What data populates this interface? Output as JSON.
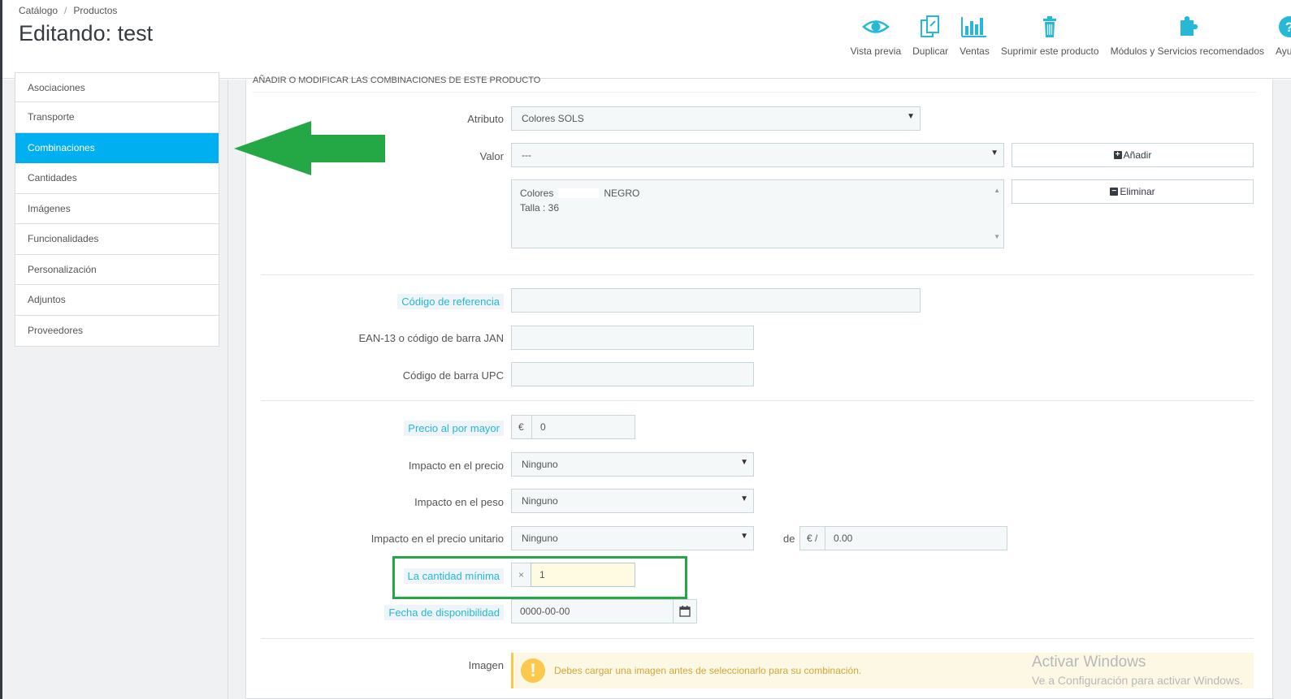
{
  "breadcrumb": {
    "item1": "Catálogo",
    "separator": "/",
    "item2": "Productos"
  },
  "page_title": "Editando: test",
  "toolbar": {
    "preview": "Vista previa",
    "duplicate": "Duplicar",
    "sales": "Ventas",
    "delete": "Suprimir este producto",
    "modules": "Módulos y Servicios recomendados",
    "help": "Ayuda"
  },
  "sidebar": {
    "items": [
      {
        "label": "Asociaciones"
      },
      {
        "label": "Transporte"
      },
      {
        "label": "Combinaciones"
      },
      {
        "label": "Cantidades"
      },
      {
        "label": "Imágenes"
      },
      {
        "label": "Funcionalidades"
      },
      {
        "label": "Personalización"
      },
      {
        "label": "Adjuntos"
      },
      {
        "label": "Proveedores"
      }
    ],
    "active": "Combinaciones"
  },
  "panel": {
    "heading": "Añadir o modificar las combinaciones de este producto"
  },
  "form": {
    "attribute": {
      "label": "Atributo",
      "value": "Colores SOLS"
    },
    "value": {
      "label": "Valor",
      "selected": "---"
    },
    "add_button": "Añadir",
    "remove_button": "Eliminar",
    "combination_list": {
      "line1_a": "Colores",
      "line1_b": "NEGRO",
      "line2": "Talla : 36"
    },
    "reference": {
      "label": "Código de referencia",
      "value": ""
    },
    "ean13": {
      "label": "EAN-13 o código de barra JAN",
      "value": ""
    },
    "upc": {
      "label": "Código de barra UPC",
      "value": ""
    },
    "wholesale_price": {
      "label": "Precio al por mayor",
      "currency": "€",
      "value": "0"
    },
    "price_impact": {
      "label": "Impacto en el precio",
      "value": "Ninguno"
    },
    "weight_impact": {
      "label": "Impacto en el peso",
      "value": "Ninguno"
    },
    "unit_price_impact": {
      "label": "Impacto en el precio unitario",
      "value": "Ninguno",
      "de_label": "de",
      "currency": "€ /",
      "amount": "0.00"
    },
    "min_quantity": {
      "label": "La cantidad mínima",
      "prefix": "×",
      "value": "1"
    },
    "availability_date": {
      "label": "Fecha de disponibilidad",
      "value": "0000-00-00"
    },
    "image": {
      "label": "Imagen",
      "alert_icon": "!",
      "alert": "Debes cargar una imagen antes de seleccionarlo para su combinación."
    }
  },
  "watermark": {
    "line1": "Activar Windows",
    "line2": "Ve a Configuración para activar Windows."
  },
  "colors": {
    "accent": "#00aff0",
    "arrow": "#24a846",
    "highlight": "#24a846",
    "warning": "#fcc94f"
  }
}
